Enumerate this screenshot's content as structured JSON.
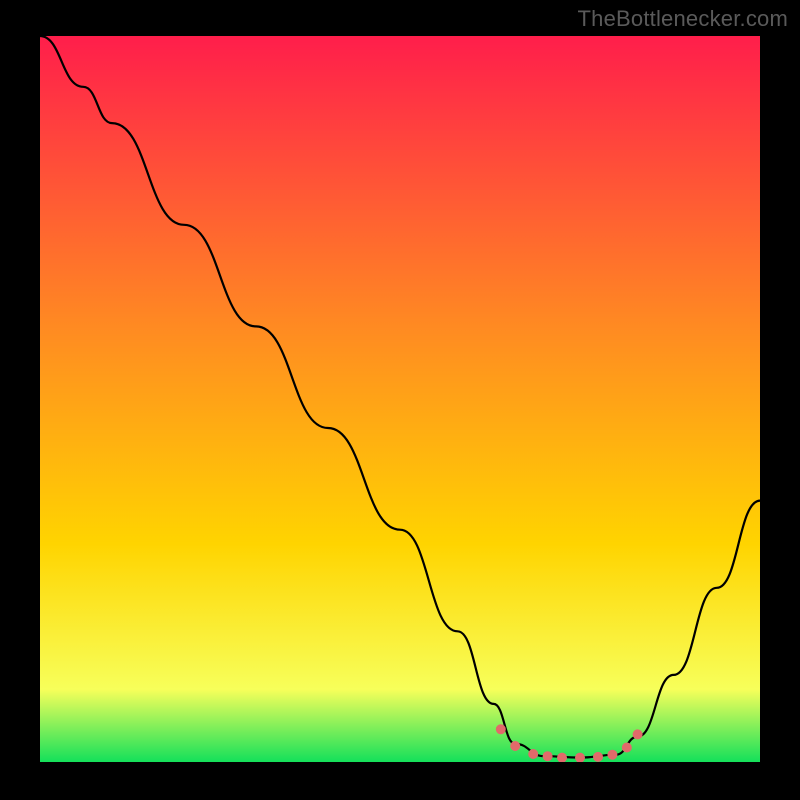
{
  "watermark": "TheBottlenecker.com",
  "chart_data": {
    "type": "line",
    "title": "",
    "xlabel": "",
    "ylabel": "",
    "xlim": [
      0,
      100
    ],
    "ylim": [
      0,
      100
    ],
    "grid": false,
    "legend": false,
    "gradient": {
      "top": "#ff1e4b",
      "mid": "#ffd400",
      "bottom": "#14e05a"
    },
    "series": [
      {
        "name": "curve",
        "color": "#000000",
        "points": [
          {
            "x": 0,
            "y": 100
          },
          {
            "x": 6,
            "y": 93
          },
          {
            "x": 10,
            "y": 88
          },
          {
            "x": 20,
            "y": 74
          },
          {
            "x": 30,
            "y": 60
          },
          {
            "x": 40,
            "y": 46
          },
          {
            "x": 50,
            "y": 32
          },
          {
            "x": 58,
            "y": 18
          },
          {
            "x": 63,
            "y": 8
          },
          {
            "x": 66,
            "y": 2.5
          },
          {
            "x": 70,
            "y": 0.8
          },
          {
            "x": 75,
            "y": 0.6
          },
          {
            "x": 80,
            "y": 1.0
          },
          {
            "x": 83,
            "y": 3.5
          },
          {
            "x": 88,
            "y": 12
          },
          {
            "x": 94,
            "y": 24
          },
          {
            "x": 100,
            "y": 36
          }
        ]
      }
    ],
    "markers": {
      "name": "trough-dots",
      "color": "#e16a6a",
      "radius": 5,
      "points": [
        {
          "x": 64,
          "y": 4.5
        },
        {
          "x": 66,
          "y": 2.2
        },
        {
          "x": 68.5,
          "y": 1.1
        },
        {
          "x": 70.5,
          "y": 0.8
        },
        {
          "x": 72.5,
          "y": 0.6
        },
        {
          "x": 75,
          "y": 0.6
        },
        {
          "x": 77.5,
          "y": 0.7
        },
        {
          "x": 79.5,
          "y": 1.0
        },
        {
          "x": 81.5,
          "y": 2.0
        },
        {
          "x": 83,
          "y": 3.8
        }
      ]
    }
  }
}
